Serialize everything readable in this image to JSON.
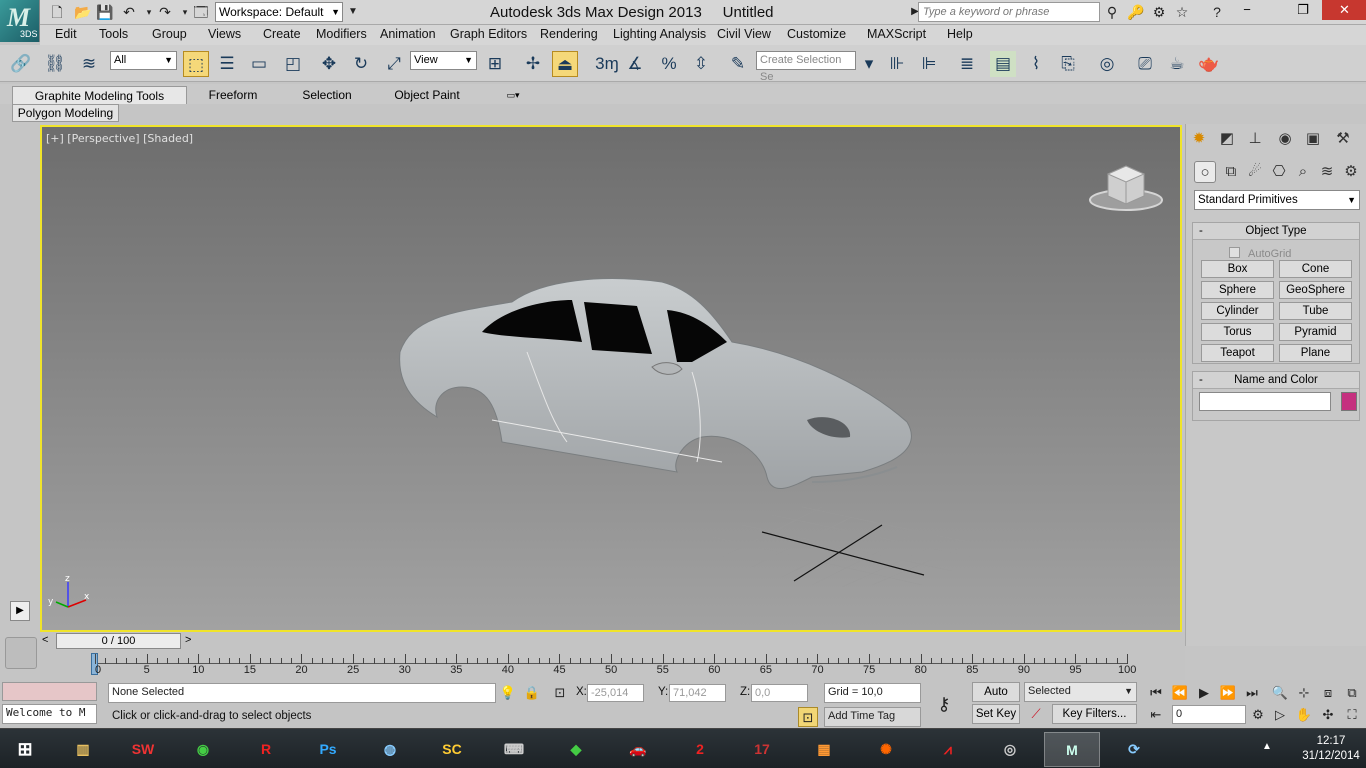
{
  "titlebar": {
    "workspace": "Workspace: Default",
    "app_title": "Autodesk 3ds Max Design 2013",
    "doc_title": "Untitled",
    "search_placeholder": "Type a keyword or phrase",
    "logo_text": "3DS"
  },
  "menu": [
    "Edit",
    "Tools",
    "Group",
    "Views",
    "Create",
    "Modifiers",
    "Animation",
    "Graph Editors",
    "Rendering",
    "Lighting Analysis",
    "Civil View",
    "Customize",
    "MAXScript",
    "Help"
  ],
  "toolbar": {
    "filter": "All",
    "ref_coord": "View",
    "selection_set": "Create Selection Se",
    "snap_label": "3"
  },
  "ribbon": {
    "tabs": [
      "Graphite Modeling Tools",
      "Freeform",
      "Selection",
      "Object Paint"
    ],
    "panel": "Polygon Modeling"
  },
  "viewport": {
    "label": "[+] [Perspective] [Shaded]"
  },
  "command_panel": {
    "category": "Standard Primitives",
    "object_type": {
      "title": "Object Type",
      "autogrid": "AutoGrid",
      "buttons": [
        "Box",
        "Cone",
        "Sphere",
        "GeoSphere",
        "Cylinder",
        "Tube",
        "Torus",
        "Pyramid",
        "Teapot",
        "Plane"
      ]
    },
    "name_color": {
      "title": "Name and Color",
      "color": "#c5307f"
    }
  },
  "timeline": {
    "frame": "0 / 100",
    "ticks": [
      "0",
      "5",
      "10",
      "15",
      "20",
      "25",
      "30",
      "35",
      "40",
      "45",
      "50",
      "55",
      "60",
      "65",
      "70",
      "75",
      "80",
      "85",
      "90",
      "95",
      "100"
    ]
  },
  "status": {
    "selection": "None Selected",
    "prompt": "Click or click-and-drag to select objects",
    "maxscript": "Welcome to M",
    "x": "-25,014",
    "y": "71,042",
    "z": "0,0",
    "grid": "Grid = 10,0",
    "add_time_tag": "Add Time Tag",
    "auto_key": "Auto Key",
    "set_key": "Set Key",
    "key_filters": "Key Filters...",
    "selected": "Selected",
    "frame_field": "0"
  },
  "taskbar": {
    "time": "12:17",
    "date": "31/12/2014"
  }
}
